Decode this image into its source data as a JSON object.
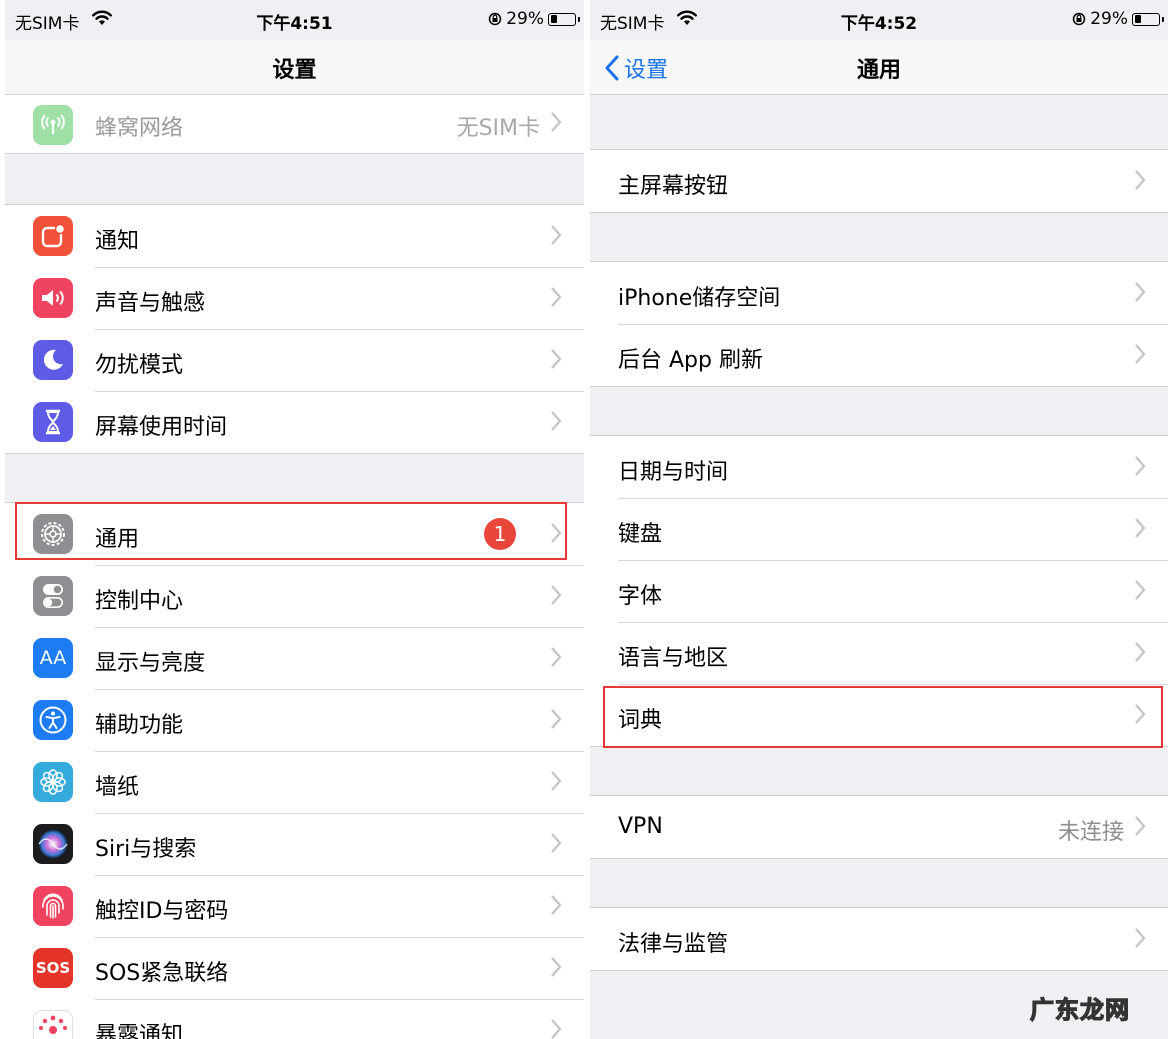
{
  "left": {
    "status": {
      "carrier": "无SIM卡",
      "time": "下午4:51",
      "battery": "29%",
      "battery_level": 0.29
    },
    "title": "设置",
    "cellular": {
      "label": "蜂窝网络",
      "detail": "无SIM卡"
    },
    "group1": [
      {
        "label": "通知",
        "icon": "notifications-icon",
        "color": "#f05138"
      },
      {
        "label": "声音与触感",
        "icon": "sounds-icon",
        "color": "#f0435f"
      },
      {
        "label": "勿扰模式",
        "icon": "moon-icon",
        "color": "#5e5ce6"
      },
      {
        "label": "屏幕使用时间",
        "icon": "hourglass-icon",
        "color": "#5e5ce6"
      }
    ],
    "group2": [
      {
        "label": "通用",
        "icon": "gear-icon",
        "color": "#8e8e93",
        "badge": "1"
      },
      {
        "label": "控制中心",
        "icon": "toggles-icon",
        "color": "#8e8e93"
      },
      {
        "label": "显示与亮度",
        "icon": "display-icon",
        "color": "#1e7cf2",
        "glyph": "AA"
      },
      {
        "label": "辅助功能",
        "icon": "accessibility-icon",
        "color": "#1e7cf2"
      },
      {
        "label": "墙纸",
        "icon": "wallpaper-icon",
        "color": "#35aadc"
      },
      {
        "label": "Siri与搜索",
        "icon": "siri-icon",
        "color": "#1c1c1e"
      },
      {
        "label": "触控ID与密码",
        "icon": "fingerprint-icon",
        "color": "#f0435f"
      },
      {
        "label": "SOS紧急联络",
        "icon": "sos-icon",
        "color": "#e5342a",
        "glyph": "SOS"
      },
      {
        "label": "暴露通知",
        "icon": "exposure-icon",
        "color": "#ffffff"
      }
    ]
  },
  "right": {
    "status": {
      "carrier": "无SIM卡",
      "time": "下午4:52",
      "battery": "29%",
      "battery_level": 0.29
    },
    "back": "设置",
    "title": "通用",
    "groups": [
      [
        {
          "label": "主屏幕按钮"
        }
      ],
      [
        {
          "label": "iPhone储存空间"
        },
        {
          "label": "后台 App 刷新"
        }
      ],
      [
        {
          "label": "日期与时间"
        },
        {
          "label": "键盘"
        },
        {
          "label": "字体"
        },
        {
          "label": "语言与地区"
        },
        {
          "label": "词典"
        }
      ],
      [
        {
          "label": "VPN",
          "detail": "未连接"
        }
      ],
      [
        {
          "label": "法律与监管"
        }
      ]
    ]
  },
  "watermark": "广东龙网"
}
